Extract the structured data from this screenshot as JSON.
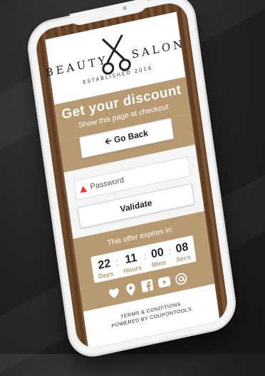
{
  "logo": {
    "word_left": "BEAUTY",
    "word_right": "SALON",
    "tagline": "ESTABLISHED 2018"
  },
  "header": {
    "title": "Get your discount",
    "subtitle": "Show this page at checkout"
  },
  "buttons": {
    "go_back": "Go Back",
    "validate": "Validate"
  },
  "form": {
    "password_placeholder": "Password"
  },
  "offer": {
    "label": "This offer expires in:",
    "countdown": [
      {
        "value": "22",
        "unit": "Days"
      },
      {
        "value": "11",
        "unit": "Hours"
      },
      {
        "value": "00",
        "unit": "Mins"
      },
      {
        "value": "08",
        "unit": "Secs"
      }
    ]
  },
  "social_icons": [
    "heart-icon",
    "location-pin-icon",
    "facebook-icon",
    "youtube-icon",
    "at-sign-icon"
  ],
  "footer": {
    "terms": "TERMS & CONDITIONS",
    "powered": "POWERED BY COUPONTOOLS"
  },
  "colors": {
    "accent": "#b79a72",
    "wood": "#6e4a2d"
  }
}
